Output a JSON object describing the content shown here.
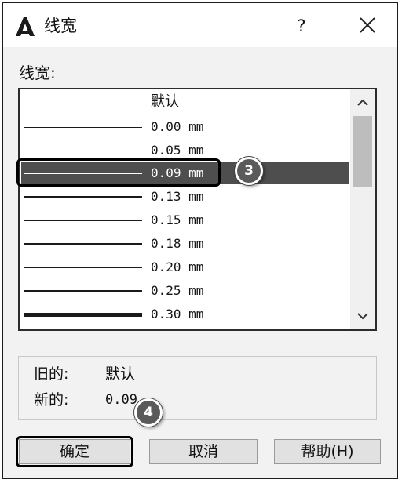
{
  "dialog": {
    "title": "线宽",
    "help_label": "?",
    "icons": {
      "app": "autocad-logo-icon",
      "close": "close-icon"
    }
  },
  "lineweights": {
    "label": "线宽:",
    "items": [
      {
        "value": "默认",
        "selected": false
      },
      {
        "value": "0.00 mm",
        "selected": false
      },
      {
        "value": "0.05 mm",
        "selected": false
      },
      {
        "value": "0.09 mm",
        "selected": true
      },
      {
        "value": "0.13 mm",
        "selected": false
      },
      {
        "value": "0.15 mm",
        "selected": false
      },
      {
        "value": "0.18 mm",
        "selected": false
      },
      {
        "value": "0.20 mm",
        "selected": false
      },
      {
        "value": "0.25 mm",
        "selected": false
      },
      {
        "value": "0.30 mm",
        "selected": false
      }
    ],
    "scroll_up": "▲",
    "scroll_down": "▼"
  },
  "info": {
    "old_label": "旧的:",
    "old_value": "默认",
    "new_label": "新的:",
    "new_value": "0.09"
  },
  "buttons": {
    "ok": "确定",
    "cancel": "取消",
    "help": "帮助(H)"
  },
  "callouts": {
    "step3": "3",
    "step4": "4"
  },
  "colors": {
    "selected_row": "#4e4e4e",
    "callout": "#5a5a5a"
  }
}
